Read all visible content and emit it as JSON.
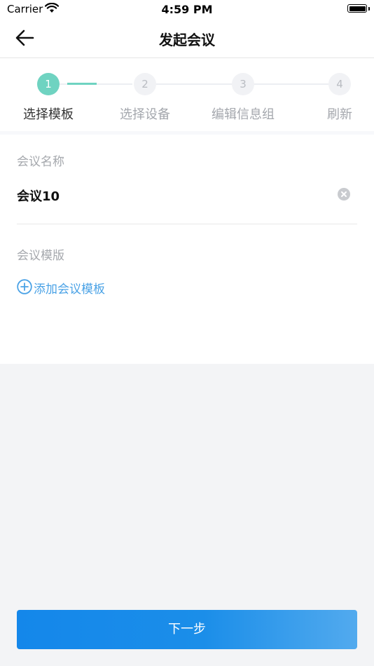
{
  "status_bar": {
    "carrier": "Carrier",
    "time": "4:59 PM"
  },
  "nav": {
    "title": "发起会议",
    "back_icon": "arrow-left-icon"
  },
  "stepper": {
    "current_step": 1,
    "steps": [
      {
        "number": "1",
        "label": "选择模板"
      },
      {
        "number": "2",
        "label": "选择设备"
      },
      {
        "number": "3",
        "label": "编辑信息组"
      },
      {
        "number": "4",
        "label": "刷新"
      }
    ],
    "active_color": "#6fd3c1"
  },
  "form": {
    "meeting_name_label": "会议名称",
    "meeting_name_value": "会议10",
    "clear_icon": "clear-circle-icon",
    "template_label": "会议模版",
    "add_template_label": "添加会议模板",
    "add_icon": "plus-circle-icon",
    "link_color": "#4aa2e6"
  },
  "footer": {
    "next_button_label": "下一步"
  }
}
